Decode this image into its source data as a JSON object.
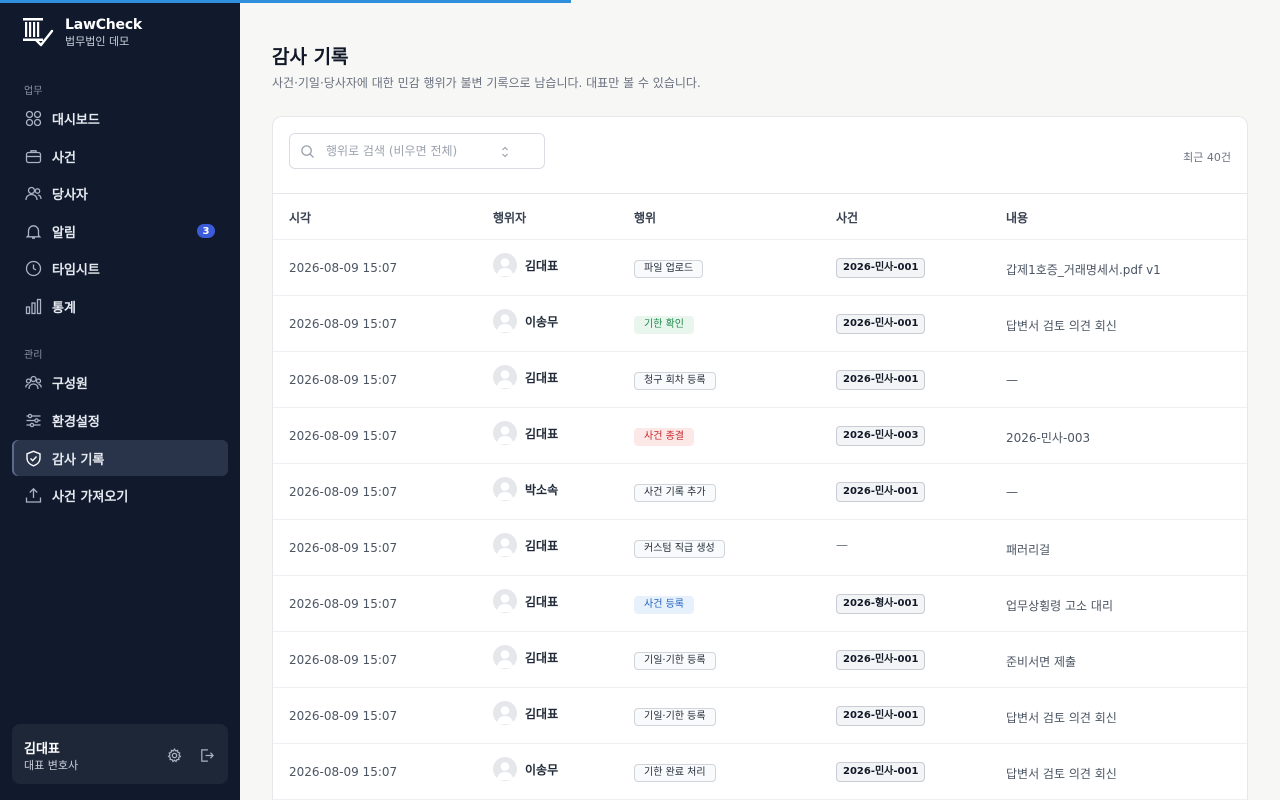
{
  "app": {
    "name": "LawCheck",
    "subtitle": "법무법인 데모"
  },
  "colors": {
    "sidebar_bg": "#101a2c",
    "accent_blue": "#2f8fdc",
    "badge_blue": "#3b5bdb",
    "tag_green": "#1f8a4c",
    "tag_red": "#c62828",
    "tag_blue": "#2563c4"
  },
  "sidebar": {
    "section_work": "업무",
    "section_admin": "관리",
    "items": [
      {
        "label": "대시보드",
        "icon": "grid-icon"
      },
      {
        "label": "사건",
        "icon": "briefcase-icon"
      },
      {
        "label": "당사자",
        "icon": "users-icon"
      },
      {
        "label": "알림",
        "icon": "bell-icon",
        "badge": "3"
      },
      {
        "label": "타임시트",
        "icon": "clock-icon"
      },
      {
        "label": "통계",
        "icon": "bar-chart-icon"
      },
      {
        "label": "구성원",
        "icon": "team-icon"
      },
      {
        "label": "환경설정",
        "icon": "sliders-icon"
      },
      {
        "label": "감사 기록",
        "icon": "shield-check-icon",
        "active": true
      },
      {
        "label": "사건 가져오기",
        "icon": "upload-icon"
      }
    ]
  },
  "user": {
    "name": "김대표",
    "role": "대표 변호사"
  },
  "page": {
    "title": "감사 기록",
    "description": "사건·기일·당사자에 대한 민감 행위가 불변 기록으로 남습니다. 대표만 볼 수 있습니다."
  },
  "search": {
    "placeholder": "행위로 검색 (비우면 전체)",
    "value": ""
  },
  "count_text": "최근 40건",
  "table": {
    "headers": [
      "시각",
      "행위자",
      "행위",
      "사건",
      "내용"
    ],
    "rows": [
      {
        "time": "2026-08-09 15:07",
        "actor": "김대표",
        "action": "파일 업로드",
        "action_style": "default",
        "case": "2026-민사-001",
        "content": "갑제1호증_거래명세서.pdf v1"
      },
      {
        "time": "2026-08-09 15:07",
        "actor": "이송무",
        "action": "기한 확인",
        "action_style": "green",
        "case": "2026-민사-001",
        "content": "답변서 검토 의견 회신"
      },
      {
        "time": "2026-08-09 15:07",
        "actor": "김대표",
        "action": "청구 회차 등록",
        "action_style": "default",
        "case": "2026-민사-001",
        "content": "—"
      },
      {
        "time": "2026-08-09 15:07",
        "actor": "김대표",
        "action": "사건 종결",
        "action_style": "red",
        "case": "2026-민사-003",
        "content": "2026-민사-003"
      },
      {
        "time": "2026-08-09 15:07",
        "actor": "박소속",
        "action": "사건 기록 추가",
        "action_style": "default",
        "case": "2026-민사-001",
        "content": "—"
      },
      {
        "time": "2026-08-09 15:07",
        "actor": "김대표",
        "action": "커스텀 직급 생성",
        "action_style": "default",
        "case": "—",
        "content": "패러리걸"
      },
      {
        "time": "2026-08-09 15:07",
        "actor": "김대표",
        "action": "사건 등록",
        "action_style": "blue",
        "case": "2026-형사-001",
        "content": "업무상횡령 고소 대리"
      },
      {
        "time": "2026-08-09 15:07",
        "actor": "김대표",
        "action": "기일·기한 등록",
        "action_style": "default",
        "case": "2026-민사-001",
        "content": "준비서면 제출"
      },
      {
        "time": "2026-08-09 15:07",
        "actor": "김대표",
        "action": "기일·기한 등록",
        "action_style": "default",
        "case": "2026-민사-001",
        "content": "답변서 검토 의견 회신"
      },
      {
        "time": "2026-08-09 15:07",
        "actor": "이송무",
        "action": "기한 완료 처리",
        "action_style": "default",
        "case": "2026-민사-001",
        "content": "답변서 검토 의견 회신"
      }
    ]
  }
}
